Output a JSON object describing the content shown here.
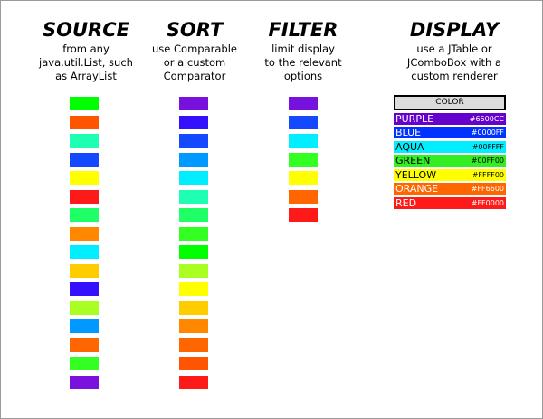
{
  "columns": {
    "source": {
      "title": "SOURCE",
      "lines": [
        "from any",
        "java.util.List, such",
        "as ArrayList"
      ]
    },
    "sort": {
      "title": "SORT",
      "lines": [
        "use Comparable",
        "or a custom",
        "Comparator"
      ]
    },
    "filter": {
      "title": "FILTER",
      "lines": [
        "limit display",
        "to the relevant",
        "options"
      ]
    },
    "display": {
      "title": "DISPLAY",
      "lines": [
        "use a JTable or",
        "JComboBox with a",
        "custom renderer"
      ]
    }
  },
  "source_swatches": [
    "#00FF00",
    "#FF5500",
    "#1FFFB4",
    "#1449FF",
    "#FFFF00",
    "#FF1A1A",
    "#1FFF66",
    "#FF8800",
    "#00EEFF",
    "#FFCC00",
    "#3311FF",
    "#AAFF22",
    "#0099FF",
    "#FF6600",
    "#33FF22",
    "#7A11DD"
  ],
  "sort_swatches": [
    "#7711DD",
    "#3311FF",
    "#1449FF",
    "#0099FF",
    "#00EEFF",
    "#1FFFB4",
    "#1FFF66",
    "#33FF22",
    "#00FF00",
    "#AAFF22",
    "#FFFF00",
    "#FFCC00",
    "#FF8800",
    "#FF6600",
    "#FF5500",
    "#FF1A1A"
  ],
  "filter_swatches": [
    "#7711DD",
    "#1449FF",
    "#00EEFF",
    "#33FF22",
    "#FFFF00",
    "#FF6600",
    "#FF1A1A"
  ],
  "legend": {
    "header": "COLOR",
    "rows": [
      {
        "name": "PURPLE",
        "hex": "#6600CC",
        "color": "#6600CC",
        "text": "light"
      },
      {
        "name": "BLUE",
        "hex": "#0000FF",
        "color": "#0033FF",
        "text": "light"
      },
      {
        "name": "AQUA",
        "hex": "#00FFFF",
        "color": "#00EEFF",
        "text": "dark"
      },
      {
        "name": "GREEN",
        "hex": "#00FF00",
        "color": "#33EE22",
        "text": "dark"
      },
      {
        "name": "YELLOW",
        "hex": "#FFFF00",
        "color": "#FFFF00",
        "text": "dark"
      },
      {
        "name": "ORANGE",
        "hex": "#FF6600",
        "color": "#FF6600",
        "text": "light"
      },
      {
        "name": "RED",
        "hex": "#FF0000",
        "color": "#FF1A1A",
        "text": "light"
      }
    ]
  }
}
